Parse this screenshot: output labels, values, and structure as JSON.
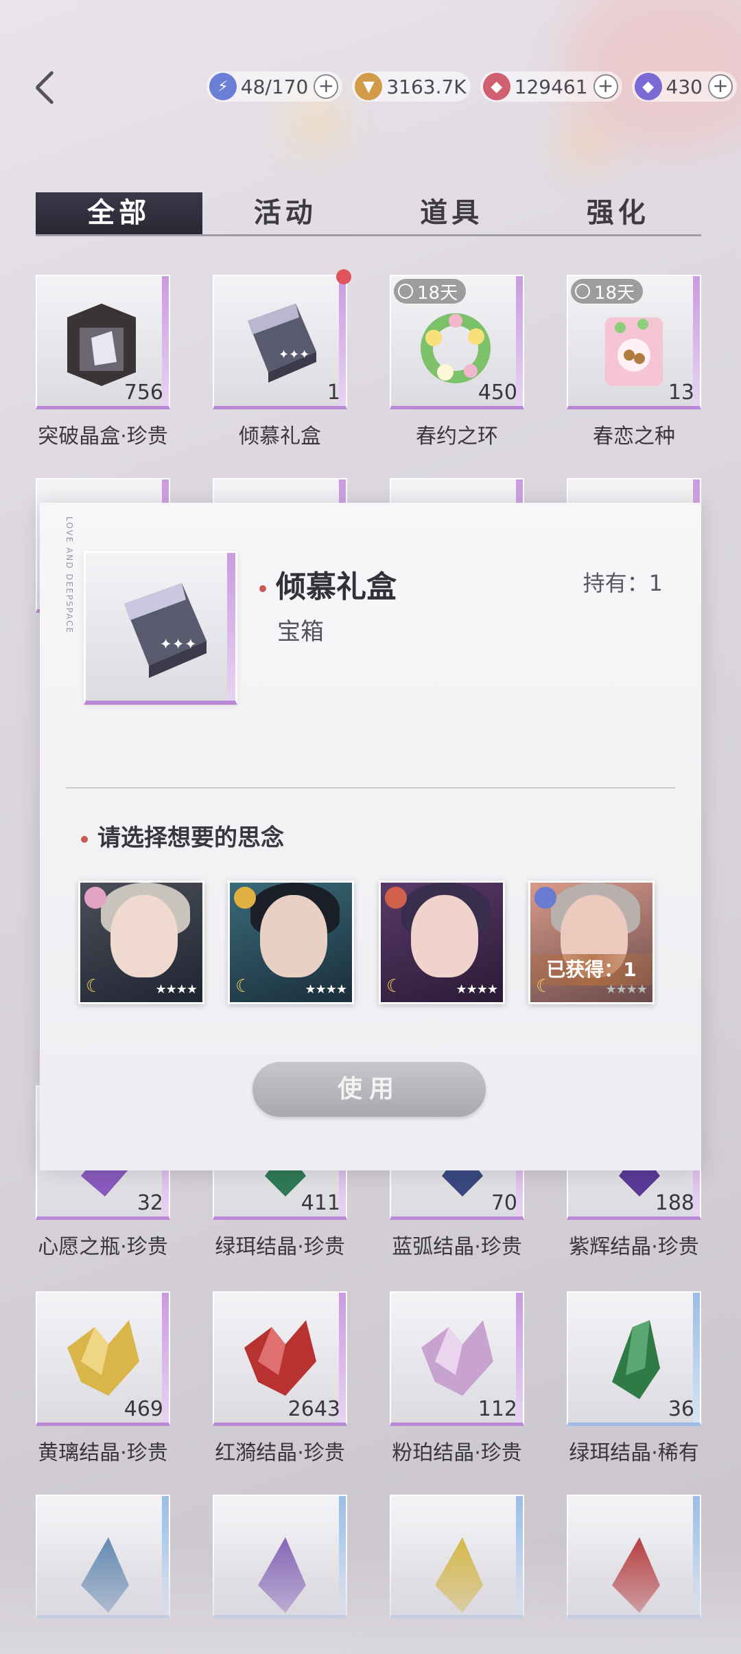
{
  "topbar": {
    "back_icon": "back-arrow-icon",
    "resources": [
      {
        "name": "stamina",
        "icon": "lightning-icon",
        "value": "48/170",
        "color": "#6b7fd6"
      },
      {
        "name": "gold",
        "icon": "coin-icon",
        "value": "3163.7K",
        "color": "#d29b4a"
      },
      {
        "name": "gem",
        "icon": "ruby-icon",
        "value": "129461",
        "color": "#d06070"
      },
      {
        "name": "diamond",
        "icon": "diamond-icon",
        "value": "430",
        "color": "#7a6ad6"
      }
    ]
  },
  "tabs": [
    "全部",
    "活动",
    "道具",
    "强化"
  ],
  "active_tab": "全部",
  "grid": {
    "row1": [
      {
        "label": "突破晶盒·珍贵",
        "qty": "756"
      },
      {
        "label": "倾慕礼盒",
        "qty": "1",
        "badge": "red-dot"
      },
      {
        "label": "春约之环",
        "qty": "450",
        "timer": "18天"
      },
      {
        "label": "春恋之种",
        "qty": "13",
        "timer": "18天"
      }
    ],
    "row3": [
      {
        "label": "心愿之瓶·珍贵",
        "qty": "32"
      },
      {
        "label": "绿珥结晶·珍贵",
        "qty": "411"
      },
      {
        "label": "蓝弧结晶·珍贵",
        "qty": "70"
      },
      {
        "label": "紫辉结晶·珍贵",
        "qty": "188"
      }
    ],
    "row4": [
      {
        "label": "黄璃结晶·珍贵",
        "qty": "469"
      },
      {
        "label": "红漪结晶·珍贵",
        "qty": "2643"
      },
      {
        "label": "粉珀结晶·珍贵",
        "qty": "112"
      },
      {
        "label": "绿珥结晶·稀有",
        "qty": "36"
      }
    ]
  },
  "modal": {
    "title": "倾慕礼盒",
    "subtitle": "宝箱",
    "owned": "持有：1",
    "choose_prompt": "请选择想要的思念",
    "side_text": "LOVE AND DEEPSPACE",
    "options": [
      {
        "name": "option-1",
        "stars": "★★★★"
      },
      {
        "name": "option-2",
        "stars": "★★★★"
      },
      {
        "name": "option-3",
        "stars": "★★★★"
      },
      {
        "name": "option-4",
        "stars": "★★★★",
        "obtained": "已获得：1"
      }
    ],
    "use_button": "使用"
  }
}
